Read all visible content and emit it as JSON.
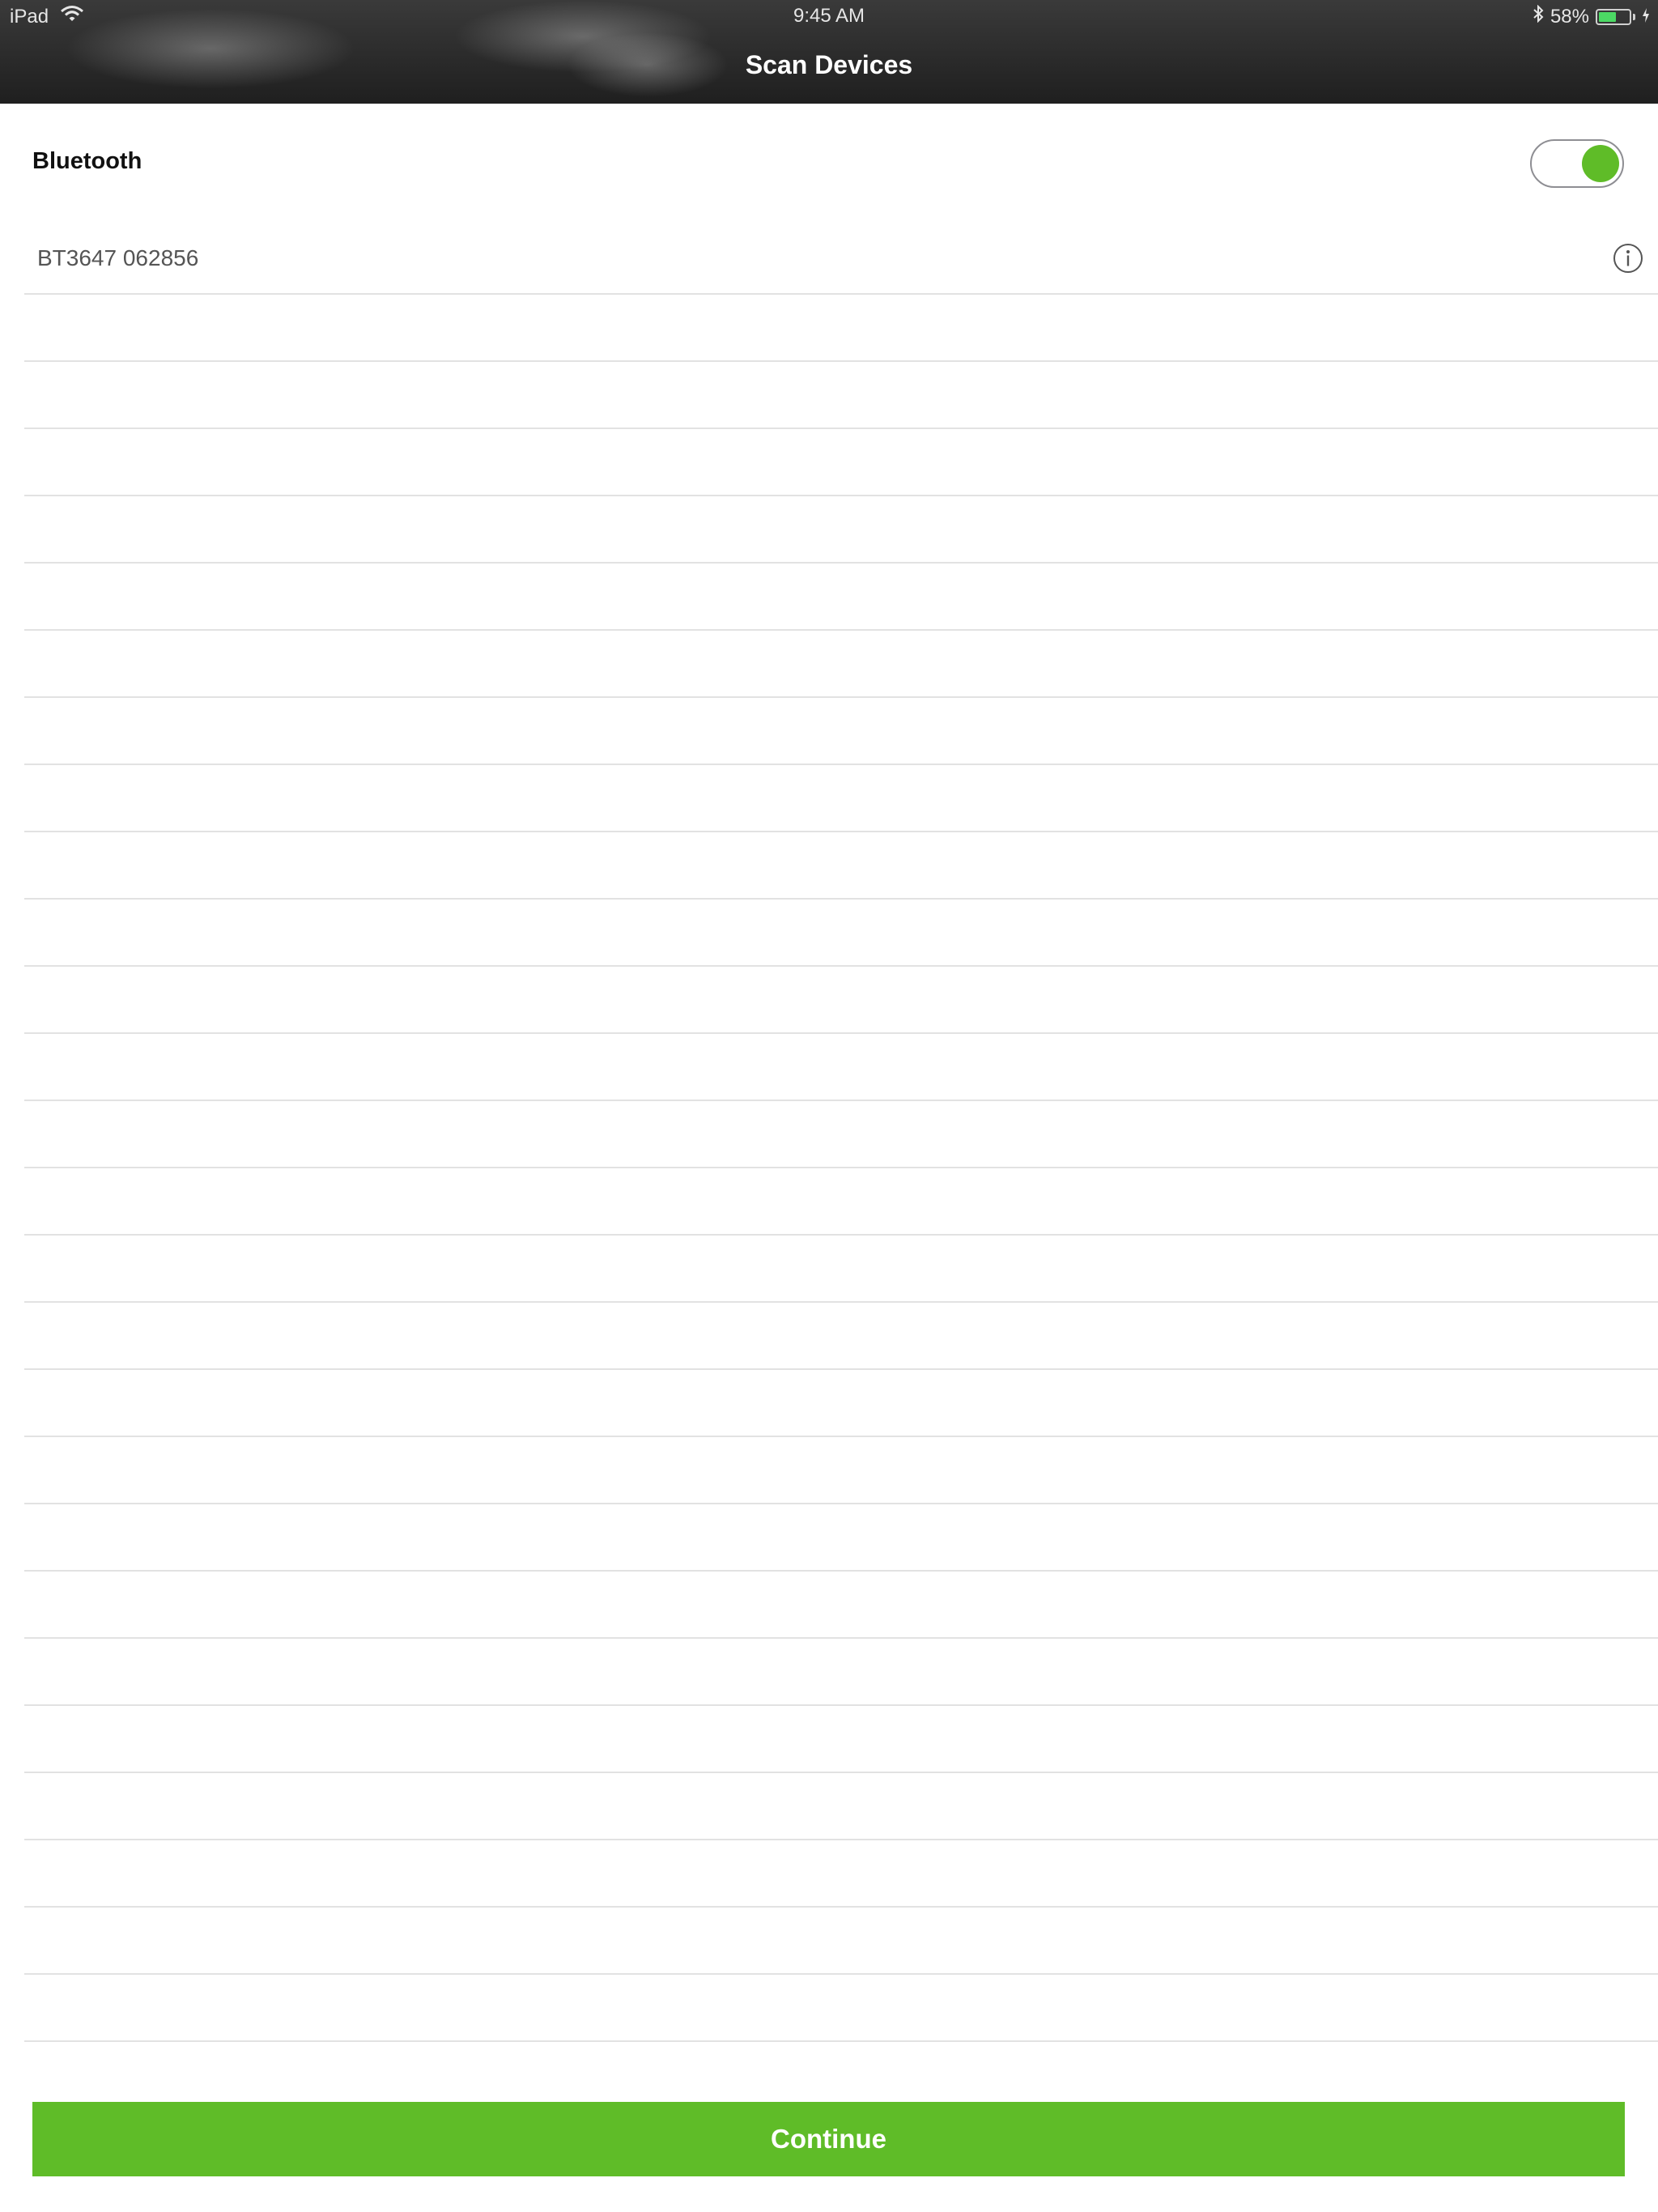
{
  "status_bar": {
    "device": "iPad",
    "time": "9:45 AM",
    "battery_text": "58%",
    "battery_level": 0.58
  },
  "nav": {
    "title": "Scan Devices"
  },
  "bluetooth": {
    "label": "Bluetooth",
    "enabled": true
  },
  "devices": [
    {
      "name": "BT3647  062856"
    }
  ],
  "empty_rows": 26,
  "actions": {
    "continue_label": "Continue"
  },
  "colors": {
    "accent": "#5fbc28",
    "battery": "#4cd964",
    "header_dark": "#1f1f1f",
    "separator": "#e2e2e2"
  }
}
